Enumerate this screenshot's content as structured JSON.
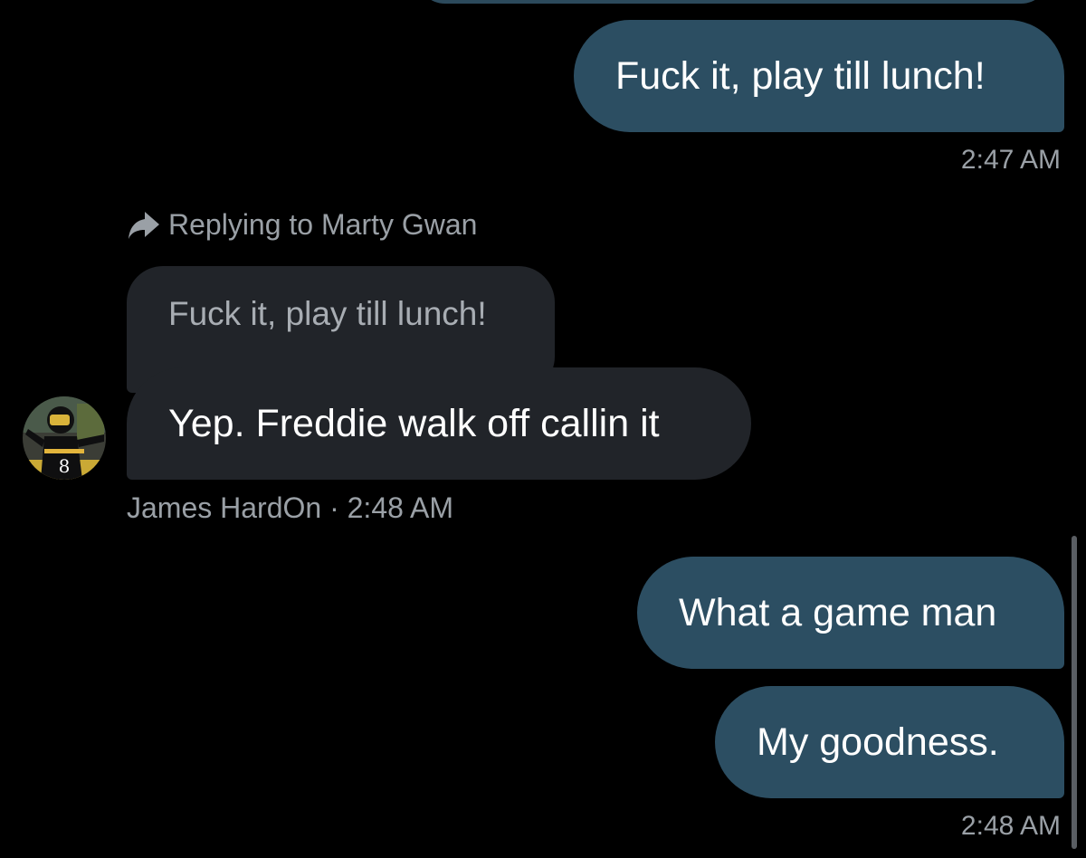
{
  "conversation": {
    "messages": [
      {
        "text": "Fuck it, play till lunch!",
        "timestamp": "2:47 AM"
      },
      {
        "replying_to": "Replying to Marty Gwan",
        "quoted_text": "Fuck it, play till lunch!",
        "text": "Yep. Freddie walk off callin it",
        "sender": "James HardOn",
        "separator": "·",
        "timestamp": "2:48 AM",
        "avatar_jersey_number": "8"
      },
      {
        "text": "What a game man"
      },
      {
        "text": "My goodness.",
        "timestamp": "2:48 AM"
      }
    ]
  },
  "colors": {
    "background": "#000000",
    "outgoing_bubble": "#2c4e62",
    "incoming_bubble": "#212429",
    "secondary_text": "#9aa0a6"
  },
  "icons": {
    "reply": "reply-arrow-icon"
  }
}
